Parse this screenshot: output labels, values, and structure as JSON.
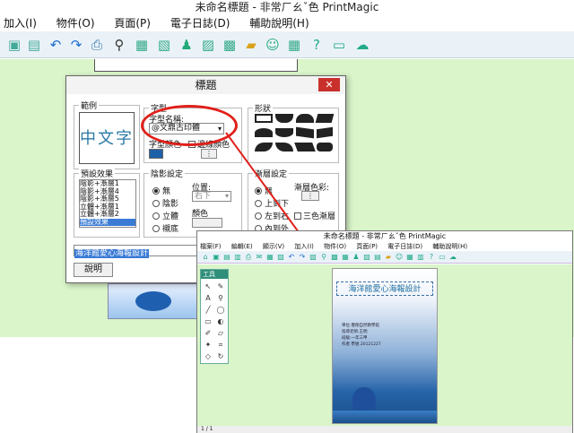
{
  "window": {
    "title": "未命名標題 - 非常ㄏㄠˇ色 PrintMagic"
  },
  "menu": [
    "加入(I)",
    "物件(O)",
    "頁面(P)",
    "電子日誌(D)",
    "輔助說明(H)"
  ],
  "toolbar_icons": [
    "new-icon",
    "copy-icon",
    "undo-icon",
    "redo-icon",
    "print-icon",
    "search-icon",
    "picture-icon",
    "image-icon",
    "person-icon",
    "frame-icon",
    "photo-icon",
    "folder-icon",
    "user-icon",
    "table-icon",
    "help-icon",
    "monitor-icon",
    "cloud-icon"
  ],
  "dialog": {
    "title": "標題",
    "close": "✕",
    "example_label": "範例",
    "example_text": "中文字",
    "font_group": "字型",
    "font_name_label": "字型名稱:",
    "font_name_value": "@文鼎古印體",
    "font_color_label": "字型顏色",
    "outline_label": "邊線顏色",
    "shape_label": "形狀",
    "preset_label": "預設效果",
    "preset_items": [
      "陰影+漸層1",
      "陰影+漸層4",
      "陰影+漸層5",
      "立體+漸層1",
      "立體+漸層2",
      "預設效果"
    ],
    "shadow_label": "陰影設定",
    "shadow_pos_label": "位置:",
    "shadow_pos_value": "右下",
    "shadow_color_label": "顏色",
    "shadow_options": [
      "無",
      "陰影",
      "立體",
      "襯底"
    ],
    "gradient_label": "漸層設定",
    "gradient_color_label": "漸層色彩:",
    "gradient_options": [
      "無",
      "上到下",
      "左到右",
      "內到外"
    ],
    "tricolor_label": "三色漸層",
    "text_input": "海洋館愛心海報設計",
    "help_button": "說明"
  },
  "inner_window": {
    "title": "未命名標題 - 非常ㄏㄠˇ色 PrintMagic",
    "menu": [
      "檔案(F)",
      "編輯(E)",
      "顯示(V)",
      "加入(I)",
      "物件(O)",
      "頁面(P)",
      "電子日誌(D)",
      "輔助說明(H)"
    ],
    "tool_panel_title": "工具",
    "doc_title": "海洋館愛心海報設計",
    "doc_lines": [
      "單位:豐翔自然教學館",
      "指導老師:王明",
      "班級:一年三甲",
      "作者  學號 20121227"
    ],
    "status": "1 / 1"
  }
}
